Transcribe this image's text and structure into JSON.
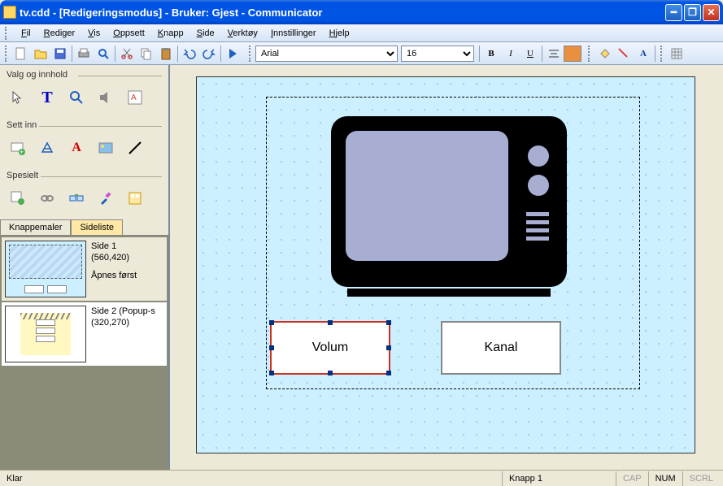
{
  "title": "tv.cdd -  [Redigeringsmodus] - Bruker: Gjest - Communicator",
  "menu": {
    "fil": "Fil",
    "rediger": "Rediger",
    "vis": "Vis",
    "oppsett": "Oppsett",
    "knapp": "Knapp",
    "side": "Side",
    "verktoy": "Verktøy",
    "innstillinger": "Innstillinger",
    "hjelp": "Hjelp"
  },
  "toolbar": {
    "font": "Arial",
    "size": "16",
    "bold": "B",
    "italic": "I",
    "underline": "U"
  },
  "panel": {
    "valg": "Valg og innhold",
    "settinn": "Sett inn",
    "spesielt": "Spesielt"
  },
  "tabs": {
    "knappemaler": "Knappemaler",
    "sideliste": "Sideliste"
  },
  "pages": [
    {
      "title": "Side 1",
      "dims": "(560,420)",
      "note": "Åpnes først"
    },
    {
      "title": "Side 2 (Popup-s",
      "dims": "(320,270)",
      "note": ""
    }
  ],
  "canvas": {
    "btn1": "Volum",
    "btn2": "Kanal"
  },
  "status": {
    "ready": "Klar",
    "obj": "Knapp 1",
    "cap": "CAP",
    "num": "NUM",
    "scrl": "SCRL"
  }
}
